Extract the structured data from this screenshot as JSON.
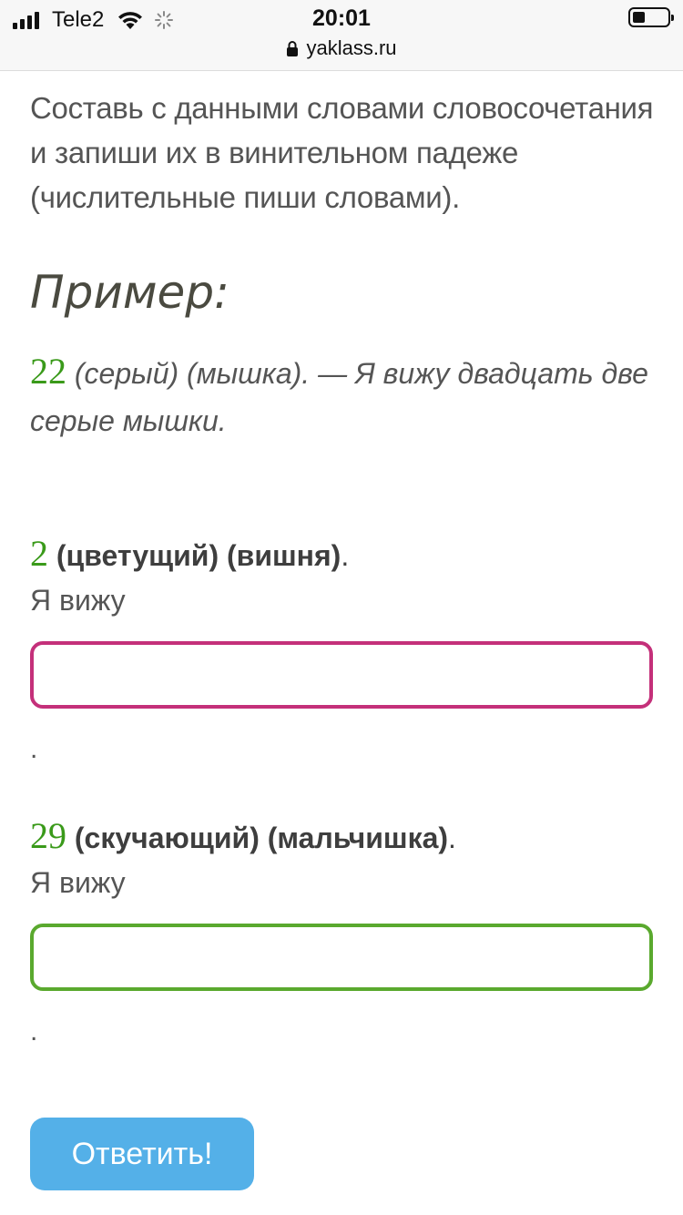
{
  "status_bar": {
    "carrier": "Tele2",
    "time": "20:01",
    "url": "yaklass.ru"
  },
  "instruction": "Составь с данными словами словосочетания и запиши их в винительном падеже (числительные пиши словами).",
  "example": {
    "title": "Пример:",
    "number": "22",
    "text": " (серый) (мышка). — Я вижу двадцать две серые мышки."
  },
  "tasks": [
    {
      "number": "2",
      "words": " (цветущий) (вишня)",
      "end": ".",
      "prompt": "Я вижу",
      "input_value": "",
      "dot": "."
    },
    {
      "number": "29",
      "words": " (скучающий) (мальчишка)",
      "end": ".",
      "prompt": "Я вижу",
      "input_value": "",
      "dot": "."
    }
  ],
  "submit_label": "Ответить!",
  "colors": {
    "number_green": "#3a9a1a",
    "input1_border": "#c4307a",
    "input2_border": "#5aa92e",
    "button_bg": "#54b0e8"
  }
}
